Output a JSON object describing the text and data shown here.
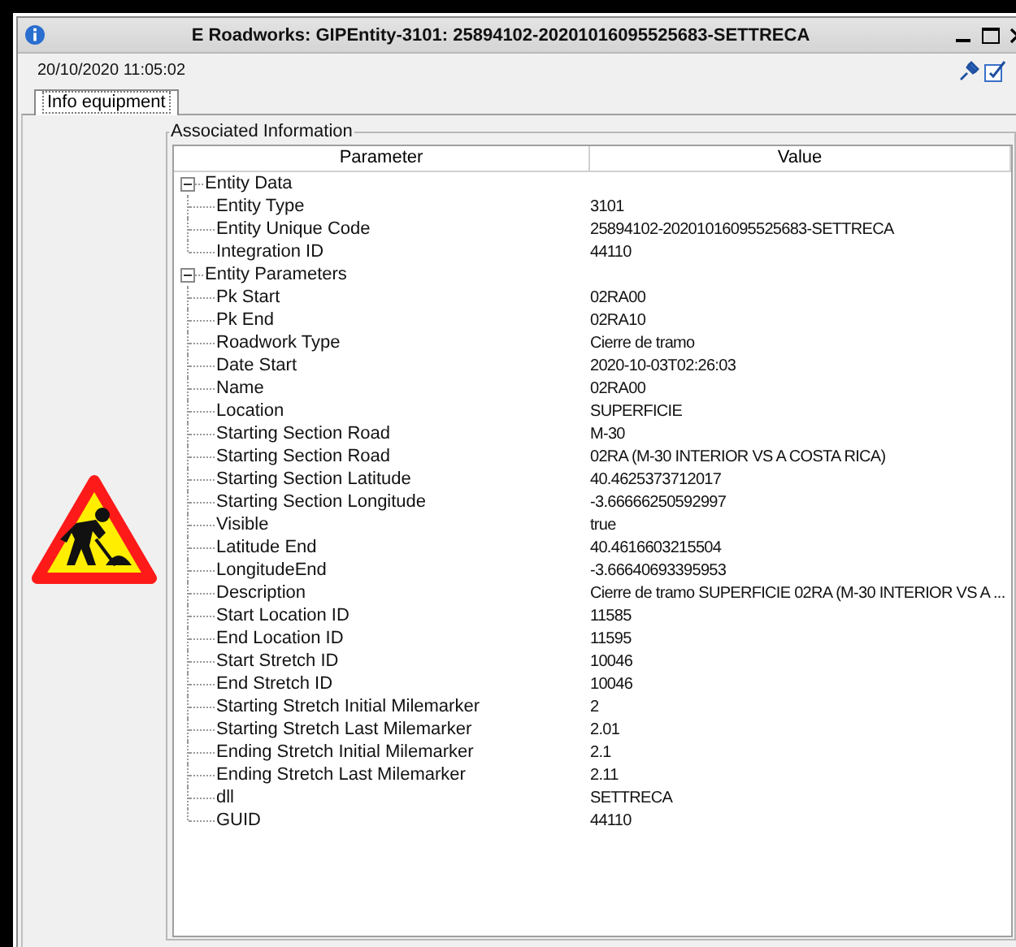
{
  "window": {
    "title": "E Roadworks: GIPEntity-3101: 25894102-20201016095525683-SETTRECA",
    "timestamp": "20/10/2020 11:05:02"
  },
  "tabs": [
    {
      "label": "Info equipment",
      "selected": true
    }
  ],
  "group_title": "Associated Information",
  "table": {
    "columns": [
      "Parameter",
      "Value"
    ],
    "rows": [
      {
        "label": "Entity Data",
        "expanded": true,
        "children": [
          {
            "label": "Entity Type",
            "value": "3101"
          },
          {
            "label": "Entity Unique Code",
            "value": "25894102-20201016095525683-SETTRECA"
          },
          {
            "label": "Integration ID",
            "value": "44110"
          }
        ]
      },
      {
        "label": "Entity Parameters",
        "expanded": true,
        "children": [
          {
            "label": "Pk Start",
            "value": "02RA00"
          },
          {
            "label": "Pk End",
            "value": "02RA10"
          },
          {
            "label": "Roadwork Type",
            "value": "Cierre de tramo"
          },
          {
            "label": "Date Start",
            "value": "2020-10-03T02:26:03"
          },
          {
            "label": "Name",
            "value": "02RA00"
          },
          {
            "label": "Location",
            "value": "SUPERFICIE"
          },
          {
            "label": "Starting Section Road",
            "value": "M-30"
          },
          {
            "label": "Starting Section Road",
            "value": "02RA (M-30 INTERIOR VS A COSTA RICA)"
          },
          {
            "label": "Starting Section Latitude",
            "value": "40.4625373712017"
          },
          {
            "label": "Starting Section Longitude",
            "value": "-3.66666250592997"
          },
          {
            "label": "Visible",
            "value": "true"
          },
          {
            "label": "Latitude End",
            "value": "40.4616603215504"
          },
          {
            "label": "LongitudeEnd",
            "value": "-3.66640693395953"
          },
          {
            "label": "Description",
            "value": "Cierre de tramo SUPERFICIE 02RA (M-30 INTERIOR VS A ..."
          },
          {
            "label": "Start Location ID",
            "value": "11585"
          },
          {
            "label": "End Location ID",
            "value": "11595"
          },
          {
            "label": "Start Stretch ID",
            "value": "10046"
          },
          {
            "label": "End Stretch ID",
            "value": "10046"
          },
          {
            "label": "Starting Stretch Initial Milemarker",
            "value": "2"
          },
          {
            "label": "Starting Stretch Last Milemarker",
            "value": "2.01"
          },
          {
            "label": "Ending Stretch Initial Milemarker",
            "value": "2.1"
          },
          {
            "label": "Ending Stretch Last Milemarker",
            "value": "2.11"
          },
          {
            "label": "dll",
            "value": "SETTRECA"
          },
          {
            "label": "GUID",
            "value": "44110"
          }
        ]
      }
    ]
  }
}
